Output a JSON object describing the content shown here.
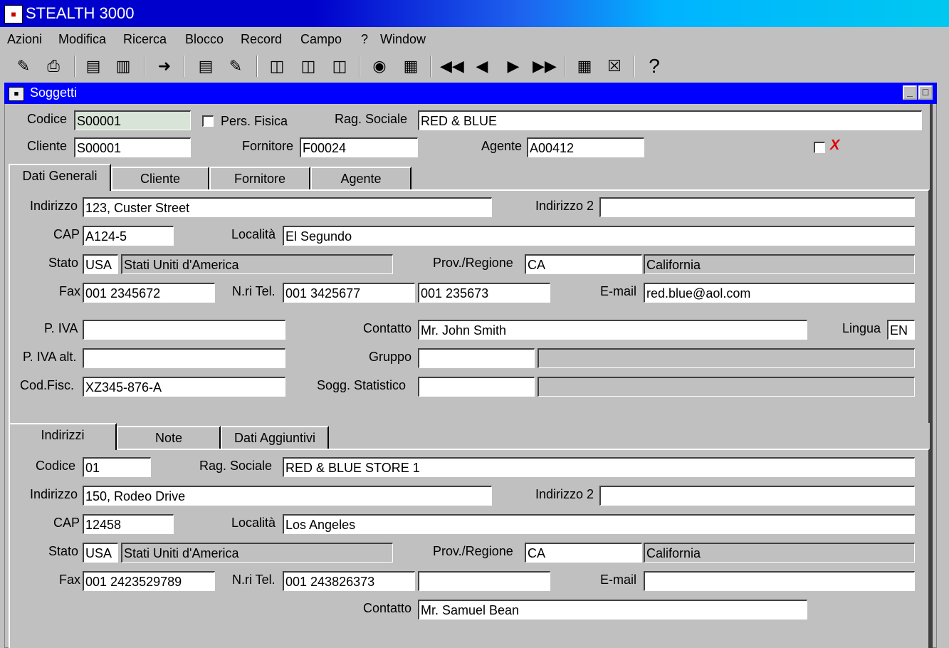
{
  "app": {
    "title": "STEALTH 3000"
  },
  "menu": [
    {
      "label": "Azioni"
    },
    {
      "label": "Modifica"
    },
    {
      "label": "Ricerca"
    },
    {
      "label": "Blocco"
    },
    {
      "label": "Record"
    },
    {
      "label": "Campo"
    },
    {
      "label": "?"
    },
    {
      "label": "Window"
    }
  ],
  "toolbar": {
    "icons": [
      "save-icon",
      "print-icon",
      "new-record-icon",
      "delete-record-icon",
      "exit-icon",
      "list-icon",
      "edit-icon",
      "query-enter-icon",
      "query-execute-icon",
      "query-cancel-icon",
      "find-icon",
      "calculator-icon",
      "first-record-icon",
      "previous-record-icon",
      "next-record-icon",
      "last-record-icon",
      "insert-row-icon",
      "delete-row-icon",
      "help-icon"
    ],
    "help_glyph": "?"
  },
  "window": {
    "title": "Soggetti"
  },
  "header": {
    "codice_label": "Codice",
    "codice_value": "S00001",
    "pers_fisica_label": "Pers. Fisica",
    "rag_sociale_label": "Rag. Sociale",
    "rag_sociale_value": "RED & BLUE",
    "cliente_label": "Cliente",
    "cliente_value": "S00001",
    "fornitore_label": "Fornitore",
    "fornitore_value": "F00024",
    "agente_label": "Agente",
    "agente_value": "A00412",
    "x_mark": "X"
  },
  "tabs_top": [
    {
      "label": "Dati Generali"
    },
    {
      "label": "Cliente"
    },
    {
      "label": "Fornitore"
    },
    {
      "label": "Agente"
    }
  ],
  "generali": {
    "indirizzo_label": "Indirizzo",
    "indirizzo_value": "123, Custer Street",
    "indirizzo2_label": "Indirizzo 2",
    "indirizzo2_value": "",
    "cap_label": "CAP",
    "cap_value": "A124-5",
    "localita_label": "Località",
    "localita_value": "El Segundo",
    "stato_label": "Stato",
    "stato_code": "USA",
    "stato_name": "Stati Uniti d'America",
    "prov_label": "Prov./Regione",
    "prov_code": "CA",
    "prov_name": "California",
    "fax_label": "Fax",
    "fax_value": "001 2345672",
    "tel_label": "N.ri Tel.",
    "tel1_value": "001 3425677",
    "tel2_value": "001 235673",
    "email_label": "E-mail",
    "email_value": "red.blue@aol.com",
    "piva_label": "P. IVA",
    "piva_value": "",
    "contatto_label": "Contatto",
    "contatto_value": "Mr. John Smith",
    "lingua_label": "Lingua",
    "lingua_value": "EN",
    "piva_alt_label": "P. IVA alt.",
    "piva_alt_value": "",
    "gruppo_label": "Gruppo",
    "gruppo_value": "",
    "gruppo_desc": "",
    "codfisc_label": "Cod.Fisc.",
    "codfisc_value": "XZ345-876-A",
    "sogg_stat_label": "Sogg. Statistico",
    "sogg_stat_value": "",
    "sogg_stat_desc": ""
  },
  "tabs_bottom": [
    {
      "label": "Indirizzi"
    },
    {
      "label": "Note"
    },
    {
      "label": "Dati Aggiuntivi"
    }
  ],
  "indirizzi": {
    "codice_label": "Codice",
    "codice_value": "01",
    "rag_sociale_label": "Rag. Sociale",
    "rag_sociale_value": "RED & BLUE STORE 1",
    "indirizzo_label": "Indirizzo",
    "indirizzo_value": "150, Rodeo Drive",
    "indirizzo2_label": "Indirizzo 2",
    "indirizzo2_value": "",
    "cap_label": "CAP",
    "cap_value": "12458",
    "localita_label": "Località",
    "localita_value": "Los Angeles",
    "stato_label": "Stato",
    "stato_code": "USA",
    "stato_name": "Stati Uniti d'America",
    "prov_label": "Prov./Regione",
    "prov_code": "CA",
    "prov_name": "California",
    "fax_label": "Fax",
    "fax_value": "001 2423529789",
    "tel_label": "N.ri Tel.",
    "tel1_value": "001 243826373",
    "tel2_value": "",
    "email_label": "E-mail",
    "email_value": "",
    "contatto_label": "Contatto",
    "contatto_value": "Mr. Samuel Bean"
  }
}
